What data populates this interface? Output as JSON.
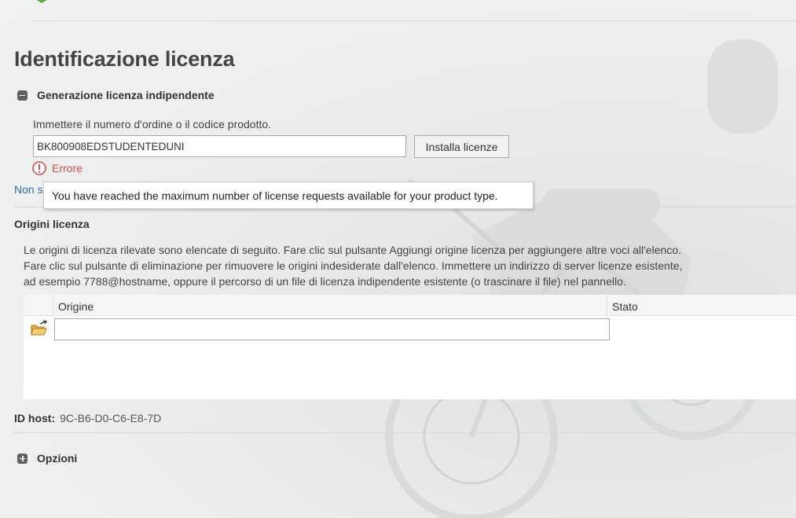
{
  "page": {
    "title": "Identificazione licenza"
  },
  "standalone_section": {
    "label": "Generazione licenza indipendente",
    "expanded": true,
    "prompt": "Immettere il numero d'ordine o il codice prodotto.",
    "order_input_value": "BK800908EDSTUDENTEDUNI",
    "install_button": "Installa licenze",
    "error_label": "Errore",
    "link_partial": "Non s"
  },
  "tooltip": {
    "text": "You have reached the maximum number of license requests available for your product type."
  },
  "license_origins": {
    "heading": "Origini licenza",
    "description_lines": [
      "Le origini di licenza rilevate sono elencate di seguito. Fare clic sul pulsante Aggiungi origine licenza per aggiungere altre voci all'elenco.",
      "Fare clic sul pulsante di eliminazione per rimuovere le origini indesiderate dall'elenco. Immettere un indirizzo di server licenze esistente,",
      "ad esempio 7788@hostname, oppure il percorso di un file di licenza indipendente esistente (o trascinare il file) nel pannello."
    ],
    "columns": {
      "origin": "Origine",
      "status": "Stato"
    },
    "new_origin_value": ""
  },
  "host": {
    "label": "ID host:",
    "value": "9C-B6-D0-C6-E8-7D"
  },
  "options_section": {
    "label": "Opzioni",
    "expanded": false
  },
  "icons": {
    "logo": "ptc-logo",
    "collapse": "minus-square-icon",
    "expand": "plus-square-icon",
    "error": "error-circle-icon",
    "add_origin": "folder-open-icon"
  },
  "colors": {
    "error": "#d94a4a",
    "link": "#2f6ea8",
    "logo_green": "#5bab3d",
    "background": "#eeefef"
  }
}
